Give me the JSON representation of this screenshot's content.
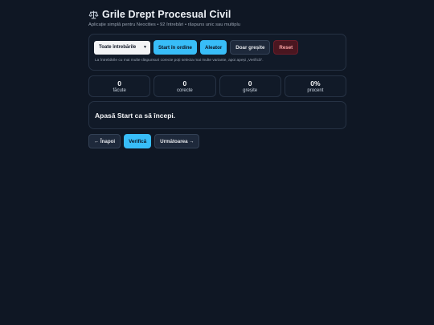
{
  "header": {
    "icon": "scales-icon",
    "title": "Grile Drept Procesual Civil",
    "subtitle": "Aplicație simplă pentru Neocities • 92 întrebări • răspuns unic sau multiplu"
  },
  "controls": {
    "select_value": "Toate întrebările",
    "start_order_label": "Start în ordine",
    "random_label": "Aleator",
    "wrong_only_label": "Doar greșite",
    "reset_label": "Reset",
    "hint": "La întrebările cu mai multe răspunsuri corecte poți selecta mai multe variante, apoi apeși „Verifică”."
  },
  "stats": {
    "done_value": "0",
    "done_label": "făcute",
    "correct_value": "0",
    "correct_label": "corecte",
    "wrong_value": "0",
    "wrong_label": "greșite",
    "percent_value": "0%",
    "percent_label": "procent"
  },
  "question": {
    "text": "Apasă Start ca să începi."
  },
  "nav": {
    "prev_label": "← Înapoi",
    "check_label": "Verifică",
    "next_label": "Următoarea →"
  },
  "colors": {
    "background": "#0f1724",
    "accent": "#38bdf8",
    "danger": "#4a1620"
  }
}
